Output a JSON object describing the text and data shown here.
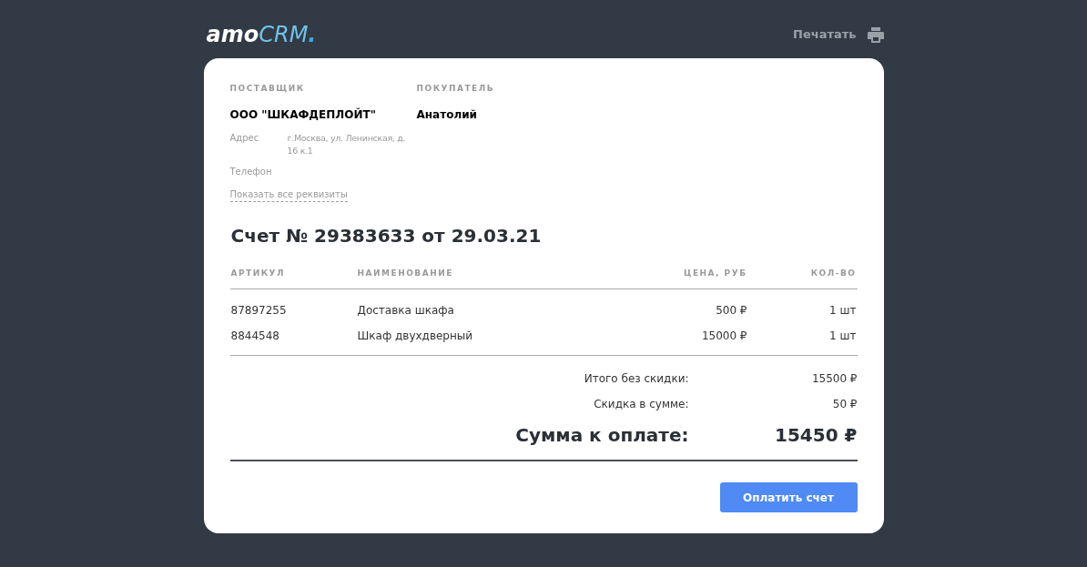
{
  "header": {
    "logo": {
      "part_1": "amo",
      "part_2": "CRM",
      "part_3": "."
    },
    "print_label": "Печатать"
  },
  "supplier": {
    "heading": "ПОСТАВЩИК",
    "name": "ООО \"ШКАФДЕПЛОЙТ\"",
    "fields": [
      {
        "label": "Адрес",
        "value": "г.Москва, ул. Ленинская, д. 16 к.1"
      },
      {
        "label": "Телефон"
      }
    ],
    "details_link": "Показать все реквизиты"
  },
  "buyer": {
    "heading": "ПОКУПАТЕЛЬ",
    "name": "Анатолий"
  },
  "invoice_title": "Счет № 29383633 от 29.03.21",
  "table": {
    "columns": [
      "АРТИКУЛ",
      "НАИМЕНОВАНИЕ",
      "ЦЕНА, РУБ",
      "КОЛ-ВО"
    ],
    "rows": [
      [
        "87897255",
        "Доставка шкафа",
        "500 ₽",
        "1 шт"
      ],
      [
        "8844548",
        "Шкаф двухдверный",
        "15000 ₽",
        "1 шт"
      ]
    ]
  },
  "totals": [
    {
      "kind": "normal",
      "label": "Итого без скидки:",
      "value": "15500 ₽"
    },
    {
      "kind": "normal",
      "label": "Скидка в сумме:",
      "value": "50 ₽"
    },
    {
      "kind": "grand",
      "label": "Сумма к оплате:",
      "value": "15450 ₽"
    }
  ],
  "pay_button": "Оплатить счет"
}
